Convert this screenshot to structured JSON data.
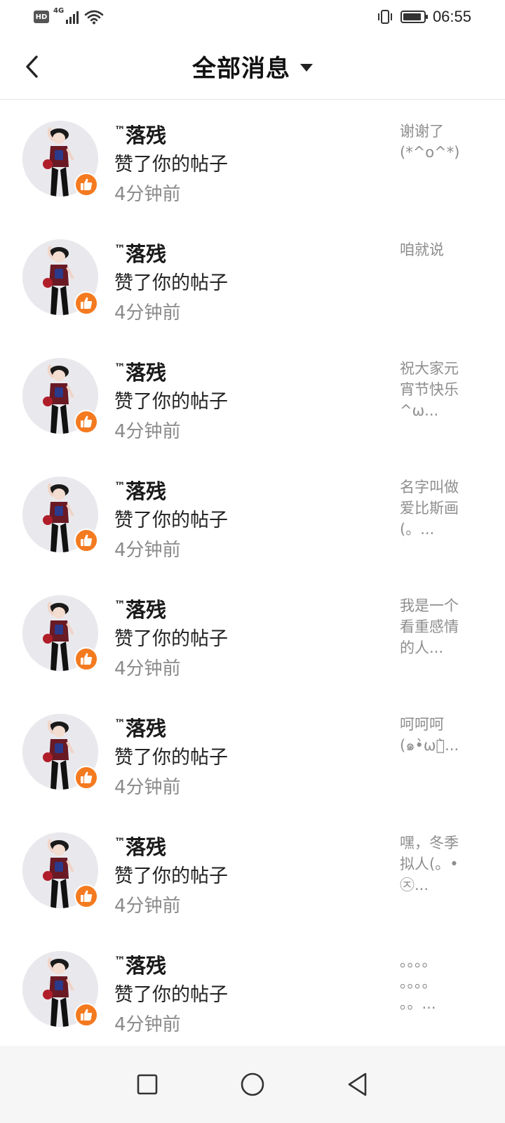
{
  "status_bar": {
    "hd": "HD",
    "network": "4G",
    "time": "06:55",
    "battery_level": 0.9
  },
  "header": {
    "title": "全部消息",
    "back_icon": "chevron-left-icon",
    "dropdown_icon": "caret-down-icon"
  },
  "notifications": [
    {
      "name": "落残",
      "tm": "™",
      "action": "赞了你的帖子",
      "time": "4分钟前",
      "preview": "谢谢了\n(*^o^*)"
    },
    {
      "name": "落残",
      "tm": "™",
      "action": "赞了你的帖子",
      "time": "4分钟前",
      "preview": "咱就说"
    },
    {
      "name": "落残",
      "tm": "™",
      "action": "赞了你的帖子",
      "time": "4分钟前",
      "preview": "祝大家元\n宵节快乐\n^ω..."
    },
    {
      "name": "落残",
      "tm": "™",
      "action": "赞了你的帖子",
      "time": "4分钟前",
      "preview": "名字叫做\n爱比斯画\n(。..."
    },
    {
      "name": "落残",
      "tm": "™",
      "action": "赞了你的帖子",
      "time": "4分钟前",
      "preview": "我是一个\n看重感情\n的人..."
    },
    {
      "name": "落残",
      "tm": "™",
      "action": "赞了你的帖子",
      "time": "4分钟前",
      "preview": "呵呵呵\n(๑•̀ωก̀..."
    },
    {
      "name": "落残",
      "tm": "™",
      "action": "赞了你的帖子",
      "time": "4分钟前",
      "preview": "嘿，冬季\n拟人(。•\n㉨..."
    },
    {
      "name": "落残",
      "tm": "™",
      "action": "赞了你的帖子",
      "time": "4分钟前",
      "preview": "。。。。\n。。。。\n。。..."
    }
  ],
  "colors": {
    "like_badge": "#f47a20",
    "muted_text": "#8a8a8a",
    "divider": "#e3e3e3"
  },
  "nav_bar": {
    "recent_icon": "square-icon",
    "home_icon": "circle-icon",
    "back_icon": "triangle-back-icon"
  }
}
